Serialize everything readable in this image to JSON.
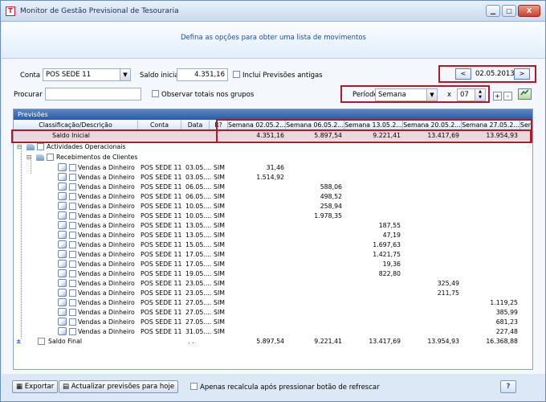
{
  "window": {
    "title": "Monitor de Gestão Previsional de Tesouraria",
    "min_label": "▁",
    "max_label": "□",
    "close_label": "X"
  },
  "banner": {
    "text": "Defina as opções para obter uma lista de movimentos"
  },
  "filters": {
    "conta_label": "Conta",
    "conta_value": "POS SEDE  11",
    "saldo_inicial_label": "Saldo inicial",
    "saldo_inicial_value": "4.351,16",
    "incluir_label": "Inclui Previsões antigas",
    "date_value": "02.05.2013",
    "prev_label": "<",
    "next_label": ">",
    "procurar_label": "Procurar :",
    "procurar_value": "",
    "observar_label": "Observar totais nos grupos",
    "periodo_label": "Período",
    "periodo_value": "Semana",
    "x_label": "x",
    "count_value": "07",
    "plus_label": "+",
    "minus_label": "-"
  },
  "grid": {
    "title": "Previsões",
    "columns": [
      "Classificação/Descrição",
      "Conta",
      "Data",
      "R?",
      "Semana 02.05.2...",
      "Semana 06.05.2...",
      "Semana 13.05.2...",
      "Semana 20.05.2...",
      "Semana 27.05.2...",
      "Sem"
    ],
    "saldo_inicial": {
      "label": "Saldo Inicial",
      "values": [
        "4.351,16",
        "5.897,54",
        "9.221,41",
        "13.417,69",
        "13.954,93"
      ]
    },
    "group1": "Actividades Operacionais",
    "group2": "Recebimentos de Clientes",
    "rows": [
      {
        "desc": "Vendas a Dinheiro",
        "conta": "POS SEDE  11",
        "data": "03.05....",
        "r": "SIM",
        "w1": "31,46",
        "w2": "",
        "w3": "",
        "w4": "",
        "w5": ""
      },
      {
        "desc": "Vendas a Dinheiro",
        "conta": "POS SEDE  11",
        "data": "03.05....",
        "r": "SIM",
        "w1": "1.514,92",
        "w2": "",
        "w3": "",
        "w4": "",
        "w5": ""
      },
      {
        "desc": "Vendas a Dinheiro",
        "conta": "POS SEDE  11",
        "data": "06.05....",
        "r": "SIM",
        "w1": "",
        "w2": "588,06",
        "w3": "",
        "w4": "",
        "w5": ""
      },
      {
        "desc": "Vendas a Dinheiro",
        "conta": "POS SEDE  11",
        "data": "06.05....",
        "r": "SIM",
        "w1": "",
        "w2": "498,52",
        "w3": "",
        "w4": "",
        "w5": ""
      },
      {
        "desc": "Vendas a Dinheiro",
        "conta": "POS SEDE  11",
        "data": "10.05....",
        "r": "SIM",
        "w1": "",
        "w2": "258,94",
        "w3": "",
        "w4": "",
        "w5": ""
      },
      {
        "desc": "Vendas a Dinheiro",
        "conta": "POS SEDE  11",
        "data": "10.05....",
        "r": "SIM",
        "w1": "",
        "w2": "1.978,35",
        "w3": "",
        "w4": "",
        "w5": ""
      },
      {
        "desc": "Vendas a Dinheiro",
        "conta": "POS SEDE  11",
        "data": "13.05....",
        "r": "SIM",
        "w1": "",
        "w2": "",
        "w3": "187,55",
        "w4": "",
        "w5": ""
      },
      {
        "desc": "Vendas a Dinheiro",
        "conta": "POS SEDE  11",
        "data": "13.05....",
        "r": "SIM",
        "w1": "",
        "w2": "",
        "w3": "47,19",
        "w4": "",
        "w5": ""
      },
      {
        "desc": "Vendas a Dinheiro",
        "conta": "POS SEDE  11",
        "data": "15.05....",
        "r": "SIM",
        "w1": "",
        "w2": "",
        "w3": "1.697,63",
        "w4": "",
        "w5": ""
      },
      {
        "desc": "Vendas a Dinheiro",
        "conta": "POS SEDE  11",
        "data": "17.05....",
        "r": "SIM",
        "w1": "",
        "w2": "",
        "w3": "1.421,75",
        "w4": "",
        "w5": ""
      },
      {
        "desc": "Vendas a Dinheiro",
        "conta": "POS SEDE  11",
        "data": "17.05....",
        "r": "SIM",
        "w1": "",
        "w2": "",
        "w3": "19,36",
        "w4": "",
        "w5": ""
      },
      {
        "desc": "Vendas a Dinheiro",
        "conta": "POS SEDE  11",
        "data": "19.05....",
        "r": "SIM",
        "w1": "",
        "w2": "",
        "w3": "822,80",
        "w4": "",
        "w5": ""
      },
      {
        "desc": "Vendas a Dinheiro",
        "conta": "POS SEDE  11",
        "data": "23.05....",
        "r": "SIM",
        "w1": "",
        "w2": "",
        "w3": "",
        "w4": "325,49",
        "w5": ""
      },
      {
        "desc": "Vendas a Dinheiro",
        "conta": "POS SEDE  11",
        "data": "23.05....",
        "r": "SIM",
        "w1": "",
        "w2": "",
        "w3": "",
        "w4": "211,75",
        "w5": ""
      },
      {
        "desc": "Vendas a Dinheiro",
        "conta": "POS SEDE  11",
        "data": "27.05....",
        "r": "SIM",
        "w1": "",
        "w2": "",
        "w3": "",
        "w4": "",
        "w5": "1.119,25"
      },
      {
        "desc": "Vendas a Dinheiro",
        "conta": "POS SEDE  11",
        "data": "27.05....",
        "r": "SIM",
        "w1": "",
        "w2": "",
        "w3": "",
        "w4": "",
        "w5": "385,99"
      },
      {
        "desc": "Vendas a Dinheiro",
        "conta": "POS SEDE  11",
        "data": "27.05....",
        "r": "SIM",
        "w1": "",
        "w2": "",
        "w3": "",
        "w4": "",
        "w5": "681,23"
      },
      {
        "desc": "Vendas a Dinheiro",
        "conta": "POS SEDE  11",
        "data": "31.05....",
        "r": "SIM",
        "w1": "",
        "w2": "",
        "w3": "",
        "w4": "",
        "w5": "227,48"
      }
    ],
    "saldo_final": {
      "label": "Saldo Final",
      "data": ". .",
      "values": [
        "5.897,54",
        "9.221,41",
        "13.417,69",
        "13.954,93",
        "16.368,88"
      ]
    }
  },
  "footer": {
    "exportar_label": "Exportar",
    "actualizar_label": "Actualizar previsões para hoje",
    "recalcula_label": "Apenas recalcula após pressionar botão de refrescar",
    "help_label": "?"
  }
}
